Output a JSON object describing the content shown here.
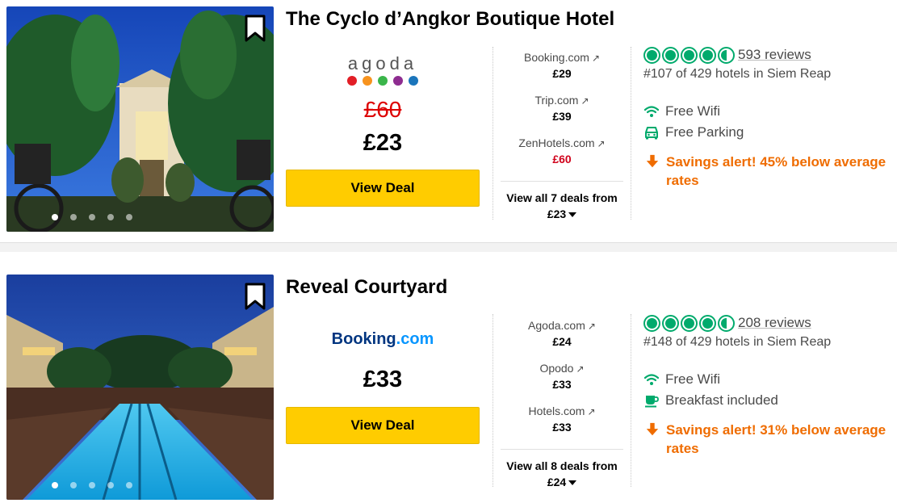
{
  "listings": [
    {
      "name": "The Cyclo d’Angkor Boutique Hotel",
      "provider": {
        "name": "agoda",
        "type": "agoda"
      },
      "old_price": "£60",
      "price": "£23",
      "view_deal_label": "View Deal",
      "photo_dots": {
        "count": 5,
        "active": 1
      },
      "deals": [
        {
          "site": "Booking.com",
          "price": "£29",
          "highlight": false
        },
        {
          "site": "Trip.com",
          "price": "£39",
          "highlight": false
        },
        {
          "site": "ZenHotels.com",
          "price": "£60",
          "highlight": true
        }
      ],
      "all_deals_line1": "View all 7 deals from",
      "all_deals_line2": "£23",
      "rating": 4.5,
      "reviews": "593 reviews",
      "rank": "#107 of 429 hotels in Siem Reap",
      "amenities": [
        {
          "icon": "wifi-icon",
          "label": "Free Wifi"
        },
        {
          "icon": "car-icon",
          "label": "Free Parking"
        }
      ],
      "savings": "Savings alert! 45% below average rates"
    },
    {
      "name": "Reveal Courtyard",
      "provider": {
        "name": "Booking.com",
        "type": "booking"
      },
      "old_price": "",
      "price": "£33",
      "view_deal_label": "View Deal",
      "photo_dots": {
        "count": 5,
        "active": 1
      },
      "deals": [
        {
          "site": "Agoda.com",
          "price": "£24",
          "highlight": false
        },
        {
          "site": "Opodo",
          "price": "£33",
          "highlight": false
        },
        {
          "site": "Hotels.com",
          "price": "£33",
          "highlight": false
        }
      ],
      "all_deals_line1": "View all 8 deals from",
      "all_deals_line2": "£24",
      "rating": 4.5,
      "reviews": "208 reviews",
      "rank": "#148 of 429 hotels in Siem Reap",
      "amenities": [
        {
          "icon": "wifi-icon",
          "label": "Free Wifi"
        },
        {
          "icon": "coffee-cup-icon",
          "label": "Breakfast included"
        }
      ],
      "savings": "Savings alert! 31% below average rates"
    }
  ],
  "colors": {
    "button": "#ffcc00",
    "rating_green": "#00aa6c",
    "savings_orange": "#ef6c00",
    "strike_red": "#d00000"
  }
}
